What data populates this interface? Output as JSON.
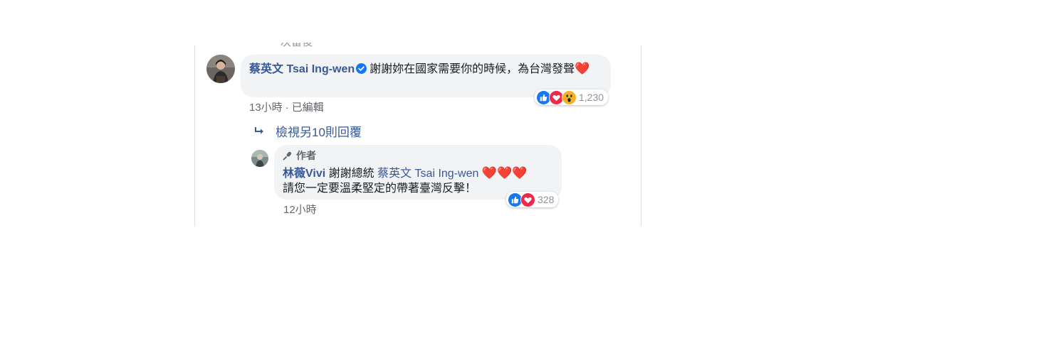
{
  "clipped_header_text": "次留後",
  "comment": {
    "author": "蔡英文 Tsai Ing-wen",
    "text": "謝謝妳在國家需要你的時候，為台灣發聲",
    "reaction_count": "1,230",
    "reactions": [
      "like-icon",
      "love-icon",
      "wow-icon"
    ],
    "time": "13小時",
    "edited": "已編輯"
  },
  "view_more_replies": "檢視另10則回覆",
  "reply": {
    "badge": "作者",
    "author": "林薇Vivi",
    "text_before_mention": "謝謝總統",
    "mention": "蔡英文 Tsai Ing-wen",
    "hearts": "❤️❤️❤️",
    "text_line2": "請您一定要溫柔堅定的帶著臺灣反擊！",
    "reaction_count": "328",
    "reactions": [
      "like-icon",
      "love-icon"
    ],
    "time": "12小時"
  },
  "colors": {
    "link": "#385898",
    "bubble": "#f2f3f5",
    "like": "#1877f2",
    "love": "#f02849",
    "wow": "#f7b125"
  }
}
